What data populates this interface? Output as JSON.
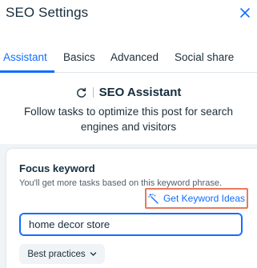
{
  "header": {
    "title": "SEO Settings"
  },
  "tabs": [
    {
      "label": "Assistant",
      "active": true
    },
    {
      "label": "Basics"
    },
    {
      "label": "Advanced"
    },
    {
      "label": "Social share"
    }
  ],
  "assistant": {
    "title": "SEO Assistant",
    "description": "Follow tasks to optimize this post for search engines and visitors"
  },
  "focus": {
    "title": "Focus keyword",
    "subtitle": "You'll get more tasks based on this keyword phrase.",
    "ideas_button": "Get Keyword Ideas",
    "input_value": "home decor store",
    "best_practices": "Best practices"
  },
  "icons": {
    "close": "close-icon",
    "refresh": "refresh-icon",
    "magic": "magic-wand-icon",
    "chevron": "chevron-down-icon"
  },
  "colors": {
    "accent": "#116dff",
    "highlight": "#e8795e",
    "panel_bg": "#f0f4f7"
  }
}
